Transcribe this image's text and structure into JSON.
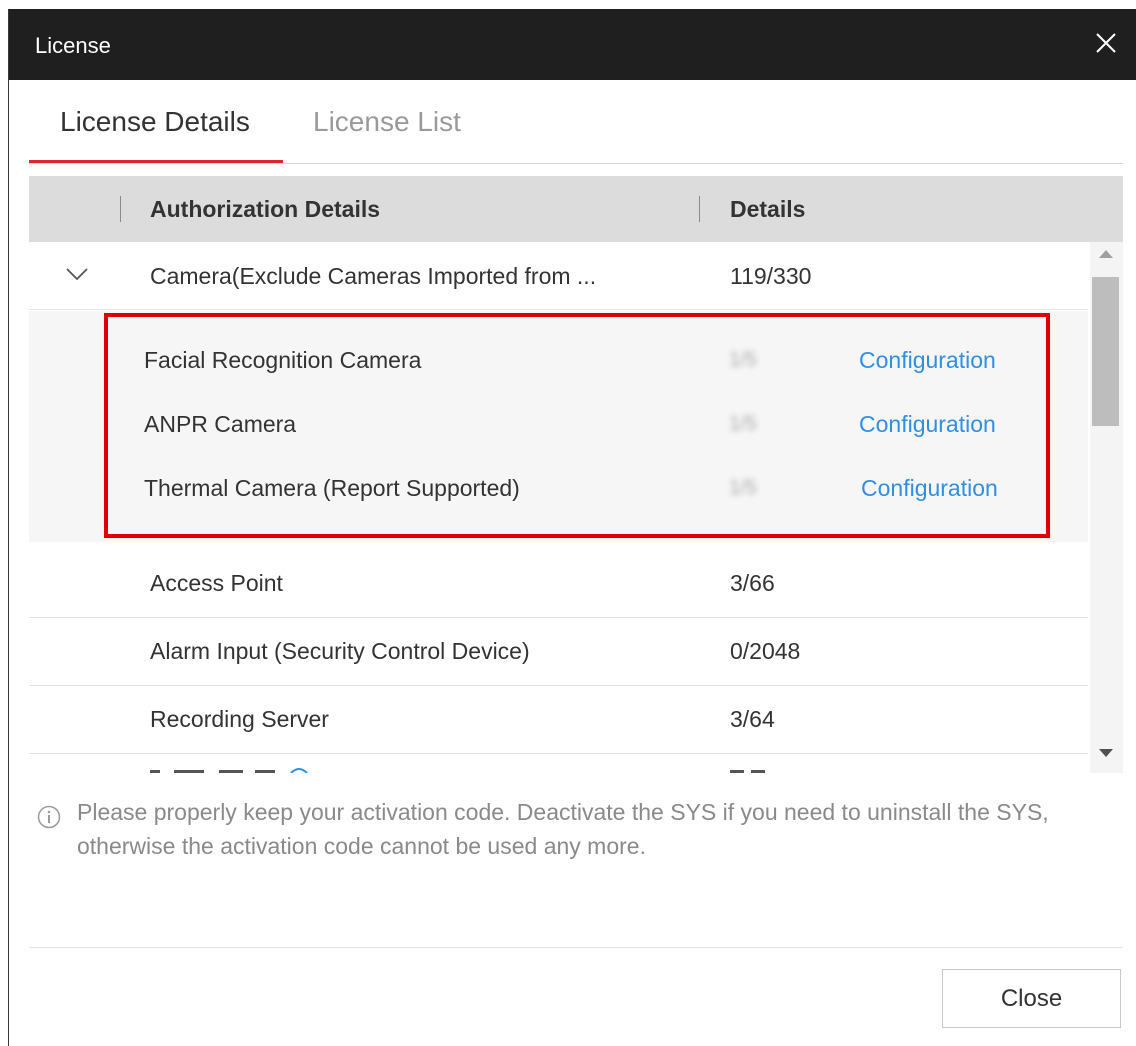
{
  "window": {
    "title": "License"
  },
  "tabs": [
    {
      "label": "License Details",
      "active": true
    },
    {
      "label": "License List",
      "active": false
    }
  ],
  "table": {
    "headers": {
      "authorization": "Authorization Details",
      "details": "Details"
    },
    "camera_row": {
      "label": "Camera(Exclude Cameras Imported from ...",
      "count": "119/330",
      "expanded": true
    },
    "camera_sub_rows": [
      {
        "label": "Facial Recognition Camera",
        "count": "1/5",
        "action": "Configuration"
      },
      {
        "label": "ANPR Camera",
        "count": "1/5",
        "action": "Configuration"
      },
      {
        "label": "Thermal Camera (Report Supported)",
        "count": "1/5",
        "action": "Configuration"
      }
    ],
    "rows": [
      {
        "label": "Access Point",
        "count": "3/66"
      },
      {
        "label": "Alarm Input (Security Control Device)",
        "count": "0/2048"
      },
      {
        "label": "Recording Server",
        "count": "3/64"
      }
    ]
  },
  "notice": "Please properly keep your activation code. Deactivate the SYS if you need to uninstall the SYS, otherwise the activation code cannot be used any more.",
  "footer": {
    "close_label": "Close"
  },
  "colors": {
    "accent": "#e0262b",
    "link": "#2f8fe5",
    "highlight": "#e00000",
    "titlebar": "#1f1f1f"
  },
  "icons": {
    "close": "close-x-icon",
    "expand": "chevron-down-icon",
    "info": "info-circle-icon"
  }
}
